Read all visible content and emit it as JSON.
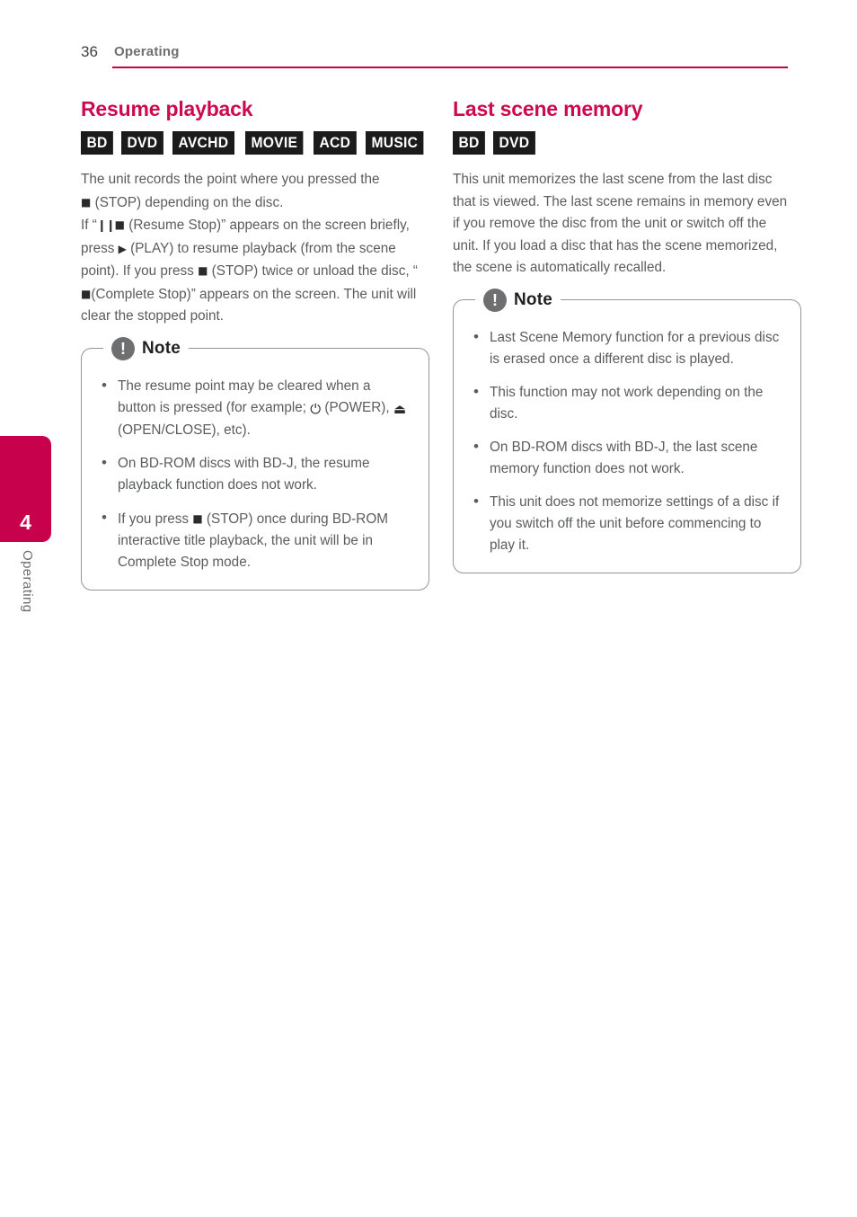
{
  "header": {
    "page_number": "36",
    "section": "Operating",
    "rule_color": "#c8014c"
  },
  "side_tab": {
    "chapter_number": "4",
    "chapter_label": "Operating",
    "color": "#c8014c"
  },
  "left_column": {
    "title": "Resume playback",
    "title_color": "#cd0a50",
    "badges": [
      "BD",
      "DVD",
      "AVCHD",
      "MOVIE",
      "ACD",
      "MUSIC"
    ],
    "paragraph": {
      "line1": "The unit records the point where you pressed the",
      "stop_glyph": "■",
      "line2_after_stop": " (STOP) depending on the disc.",
      "line3_prefix": "If “",
      "pause_glyph": "❙❙",
      "line3_after_pause": " (Resume Stop)” appears on the screen briefly,",
      "line4_prefix": "press ",
      "play_glyph": "▶",
      "line4_after_play": " (PLAY) to resume playback (from the scene point).",
      "line5_prefix": "If you press ",
      "line5_after_stop": " (STOP) twice or unload the disc, “",
      "line5_after_stop2": "(Complete Stop)” appears on the screen. The unit will clear the stopped point."
    },
    "note": {
      "icon": "exclamation-icon",
      "title": "Note",
      "items": [
        {
          "part1": "The resume point may be cleared when a button is pressed (for example; ",
          "power_glyph": "⏻",
          "part2": " (POWER), ",
          "eject_glyph": "⏏",
          "part3": " (OPEN/CLOSE), etc)."
        },
        {
          "part1": "On BD-ROM discs with BD-J, the resume playback function does not work."
        },
        {
          "part1": "If you press ",
          "stop_glyph": "■",
          "part2": " (STOP) once during BD-ROM interactive title playback, the unit will be in Complete Stop mode."
        }
      ]
    }
  },
  "right_column": {
    "title": "Last scene memory",
    "title_color": "#cd0a50",
    "badges": [
      "BD",
      "DVD"
    ],
    "paragraph": "This unit memorizes the last scene from the last disc that is viewed. The last scene remains in memory even if you remove the disc from the unit or switch off the unit. If you load a disc that has the scene memorized, the scene is automatically recalled.",
    "note": {
      "icon": "exclamation-icon",
      "title": "Note",
      "items": [
        "Last Scene Memory function for a previous disc is erased once a different disc is played.",
        "This function may not work depending on the disc.",
        "On BD-ROM discs with BD-J, the last scene memory function does not work.",
        "This unit does not memorize settings of a disc if you switch off the unit before commencing to play it."
      ]
    }
  }
}
